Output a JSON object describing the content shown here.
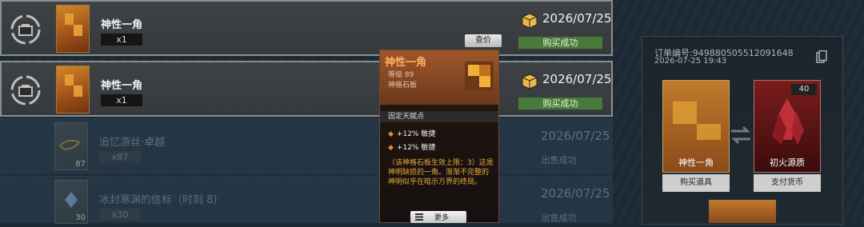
{
  "rows": [
    {
      "name": "神性一角",
      "qty": "x1",
      "date": "2026/07/25",
      "status": "购买成功",
      "price_button": "查价"
    },
    {
      "name": "神性一角",
      "qty": "x1",
      "date": "2026/07/25",
      "status": "购买成功"
    },
    {
      "name": "追忆游丝·卓越",
      "qty": "x87",
      "count": "87",
      "date": "2026/07/25",
      "status": "出售成功"
    },
    {
      "name": "冰封寒渊的信标（时刻 8）",
      "qty": "x30",
      "count": "30",
      "date": "2026/07/25",
      "status": "出售成功"
    }
  ],
  "tooltip": {
    "name": "神性一角",
    "level": "等级 89",
    "type": "神格石板",
    "section": "固定天赋点",
    "stats": [
      "+12% 敏捷",
      "+12% 敏捷"
    ],
    "description": "（该神格石板生效上限：3）这是神明缺损的一角。渐渐不完整的神明似乎在暗示万界的终局。"
  },
  "more_button": "更多",
  "detail": {
    "order_no": "订单编号:949880505512091648",
    "order_time": "2026-07-25 19:43",
    "left_card": {
      "name": "神性一角",
      "sub": "购买道具"
    },
    "right_card": {
      "name": "初火源质",
      "count": "40",
      "sub": "支付货币"
    }
  },
  "colors": {
    "success": "#4a7a3b",
    "accent_orange": "#ffb060",
    "desc": "#e8a83a"
  }
}
